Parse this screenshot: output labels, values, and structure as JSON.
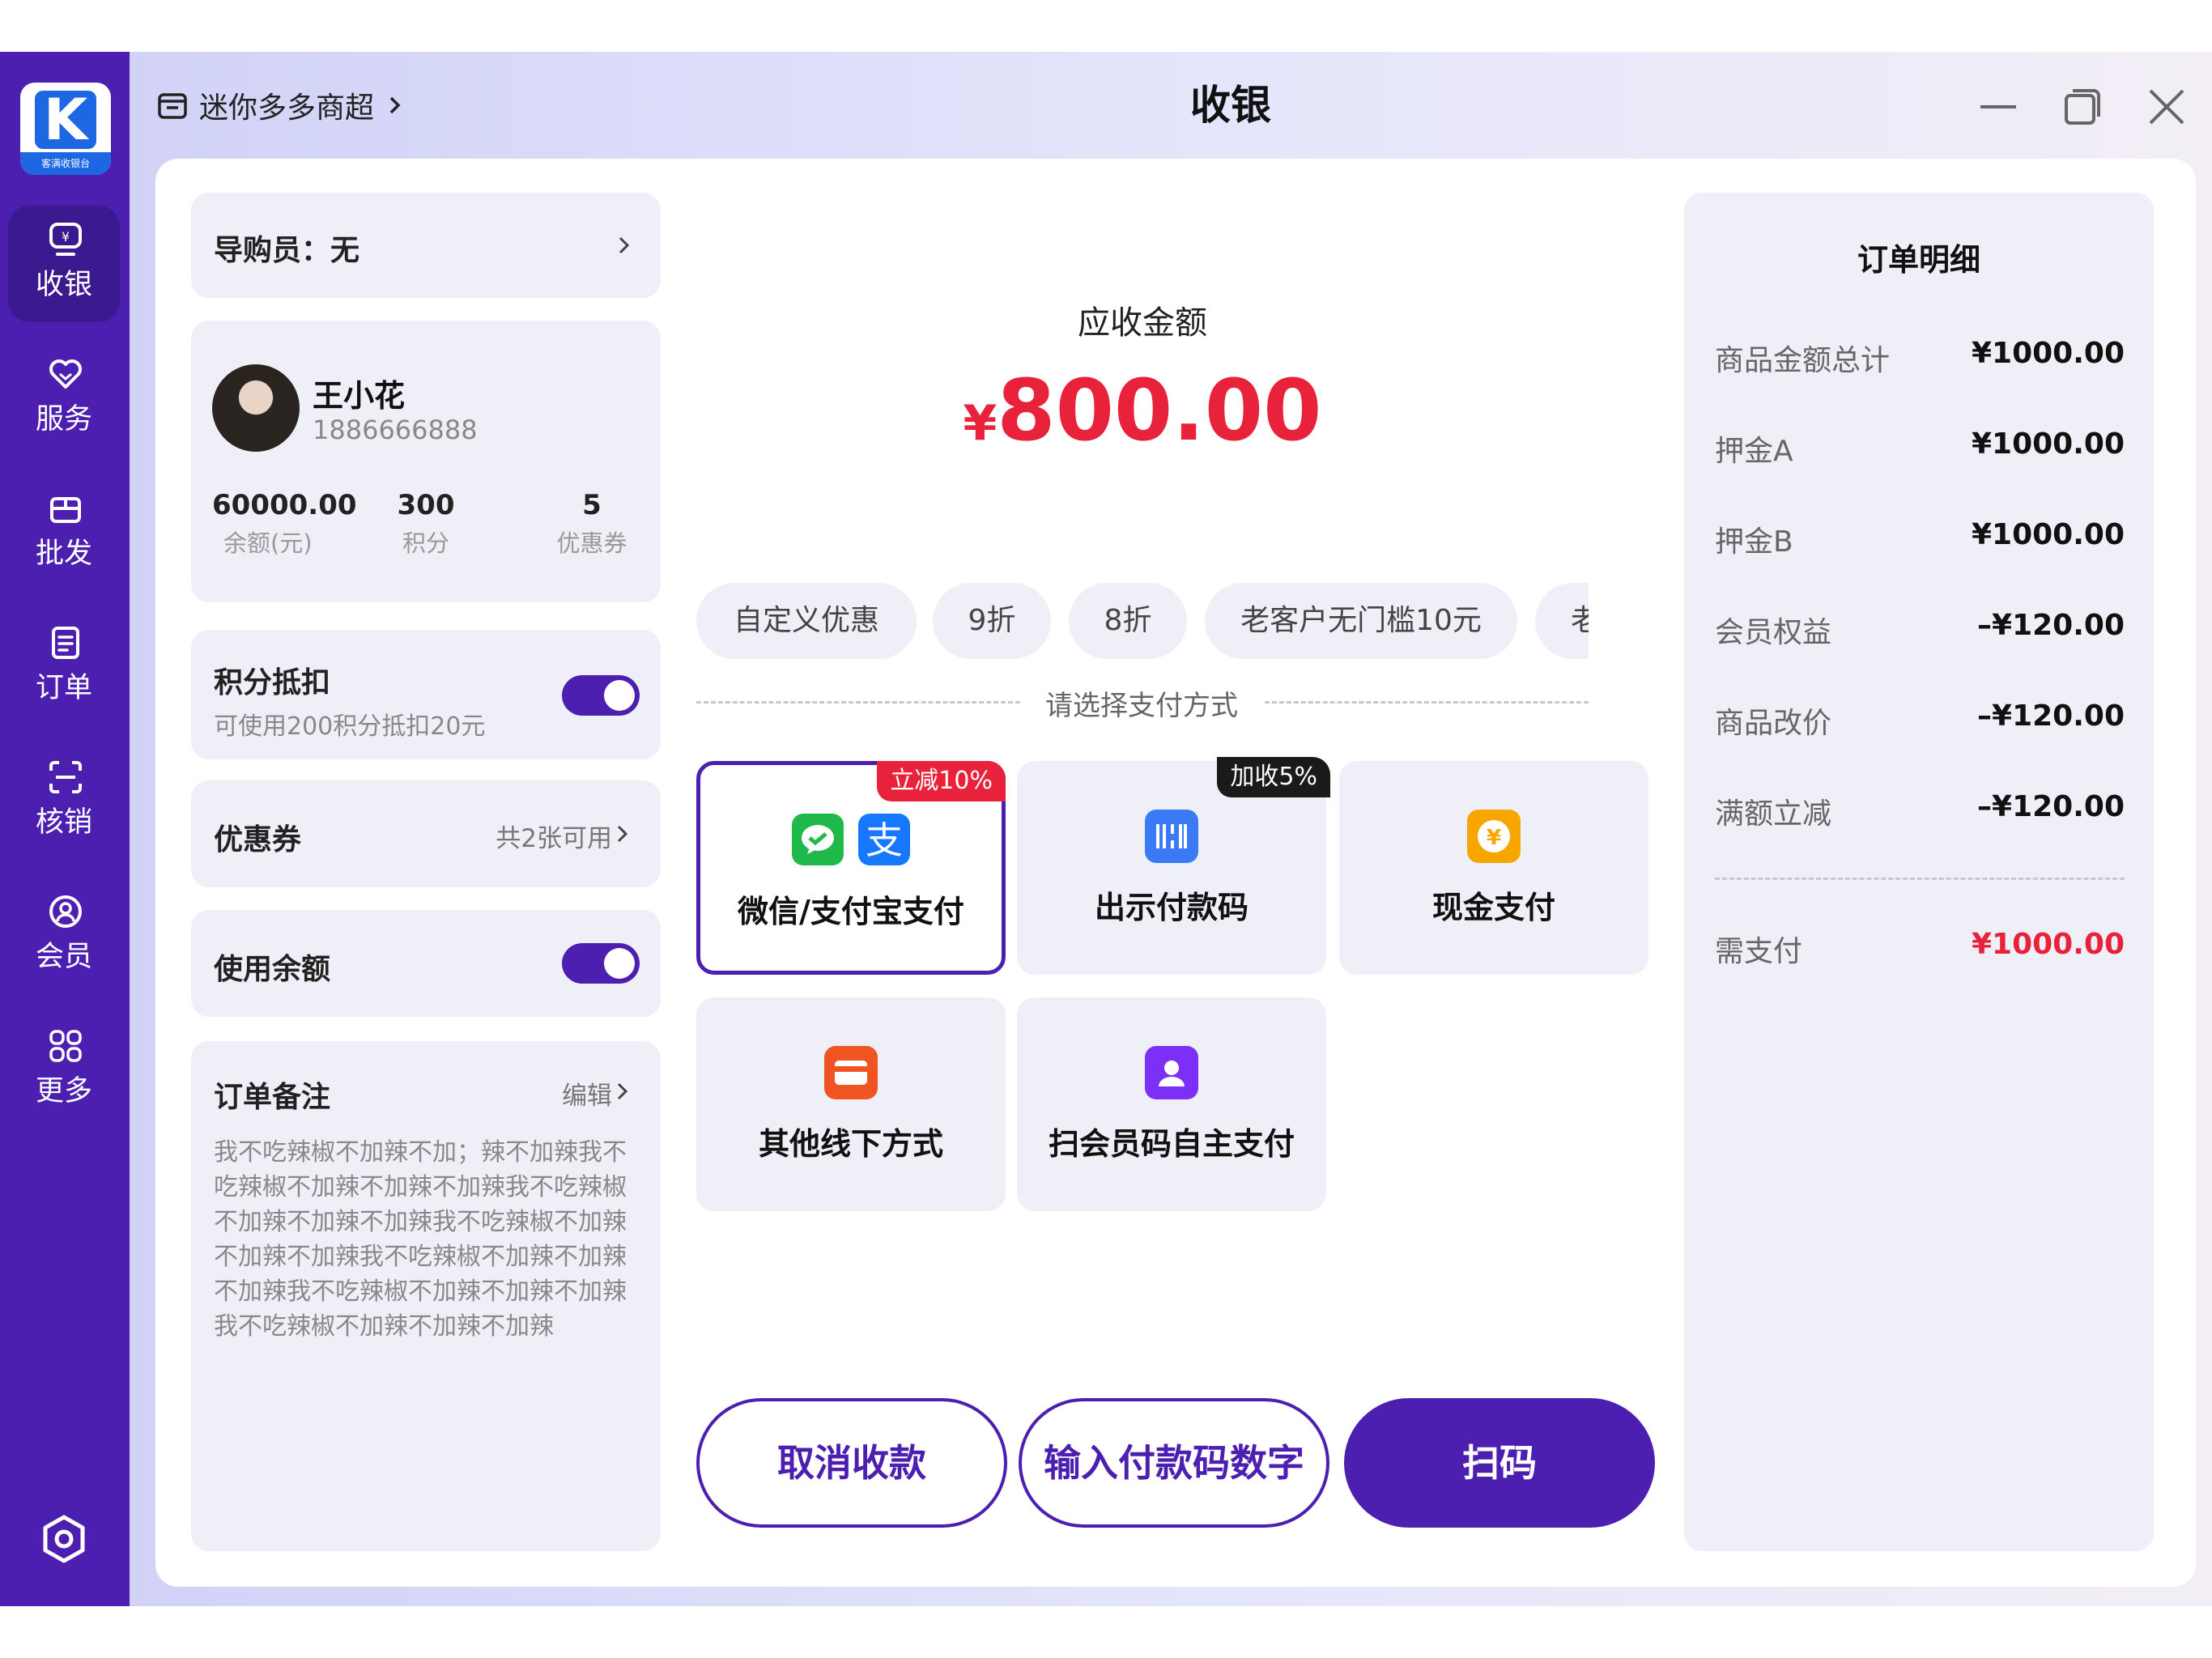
{
  "app": {
    "logo_text": "K",
    "logo_caption": "客满收银台"
  },
  "sidebar": {
    "items": [
      {
        "label": "收银",
        "icon": "cashier-icon",
        "active": true
      },
      {
        "label": "服务",
        "icon": "heart-icon"
      },
      {
        "label": "批发",
        "icon": "box-icon"
      },
      {
        "label": "订单",
        "icon": "order-list-icon"
      },
      {
        "label": "核销",
        "icon": "scan-verify-icon"
      },
      {
        "label": "会员",
        "icon": "member-icon"
      },
      {
        "label": "更多",
        "icon": "grid-more-icon"
      }
    ],
    "settings_icon": "settings-hex-icon"
  },
  "titlebar": {
    "store_name": "迷你多多商超",
    "title": "收银"
  },
  "left": {
    "guide_label": "导购员：无",
    "member": {
      "name": "王小花",
      "phone": "1886666888",
      "stats": [
        {
          "value": "60000.00",
          "label": "余额(元)"
        },
        {
          "value": "300",
          "label": "积分"
        },
        {
          "value": "5",
          "label": "优惠券"
        }
      ]
    },
    "points": {
      "title": "积分抵扣",
      "desc": "可使用200积分抵扣20元",
      "enabled": true
    },
    "coupon": {
      "title": "优惠券",
      "value": "共2张可用"
    },
    "balance": {
      "title": "使用余额",
      "enabled": true
    },
    "note": {
      "title": "订单备注",
      "edit": "编辑",
      "text": "我不吃辣椒不加辣不加；辣不加辣我不吃辣椒不加辣不加辣不加辣我不吃辣椒不加辣不加辣不加辣我不吃辣椒不加辣不加辣不加辣我不吃辣椒不加辣不加辣不加辣我不吃辣椒不加辣不加辣不加辣我不吃辣椒不加辣不加辣不加辣"
    }
  },
  "center": {
    "amount_label": "应收金额",
    "currency": "¥",
    "amount": "800.00",
    "discounts": [
      "自定义优惠",
      "9折",
      "8折",
      "老客户无门槛10元",
      "老客户"
    ],
    "pay_prompt": "请选择支付方式",
    "methods": [
      {
        "label": "微信/支付宝支付",
        "tag": "立减10%",
        "selected": true
      },
      {
        "label": "出示付款码",
        "tag": "加收5%"
      },
      {
        "label": "现金支付"
      },
      {
        "label": "其他线下方式"
      },
      {
        "label": "扫会员码自主支付"
      }
    ],
    "buttons": {
      "cancel": "取消收款",
      "input_code": "输入付款码数字",
      "scan": "扫码"
    }
  },
  "order": {
    "title": "订单明细",
    "rows": [
      {
        "label": "商品金额总计",
        "value": "¥1000.00"
      },
      {
        "label": "押金A",
        "value": "¥1000.00"
      },
      {
        "label": "押金B",
        "value": "¥1000.00"
      },
      {
        "label": "会员权益",
        "value": "–¥120.00"
      },
      {
        "label": "商品改价",
        "value": "–¥120.00"
      },
      {
        "label": "满额立减",
        "value": "–¥120.00"
      }
    ],
    "total_label": "需支付",
    "total_value": "¥1000.00"
  },
  "colors": {
    "primary": "#4d1fb1",
    "price_red": "#e8223a",
    "card_bg": "#eff0f7"
  }
}
